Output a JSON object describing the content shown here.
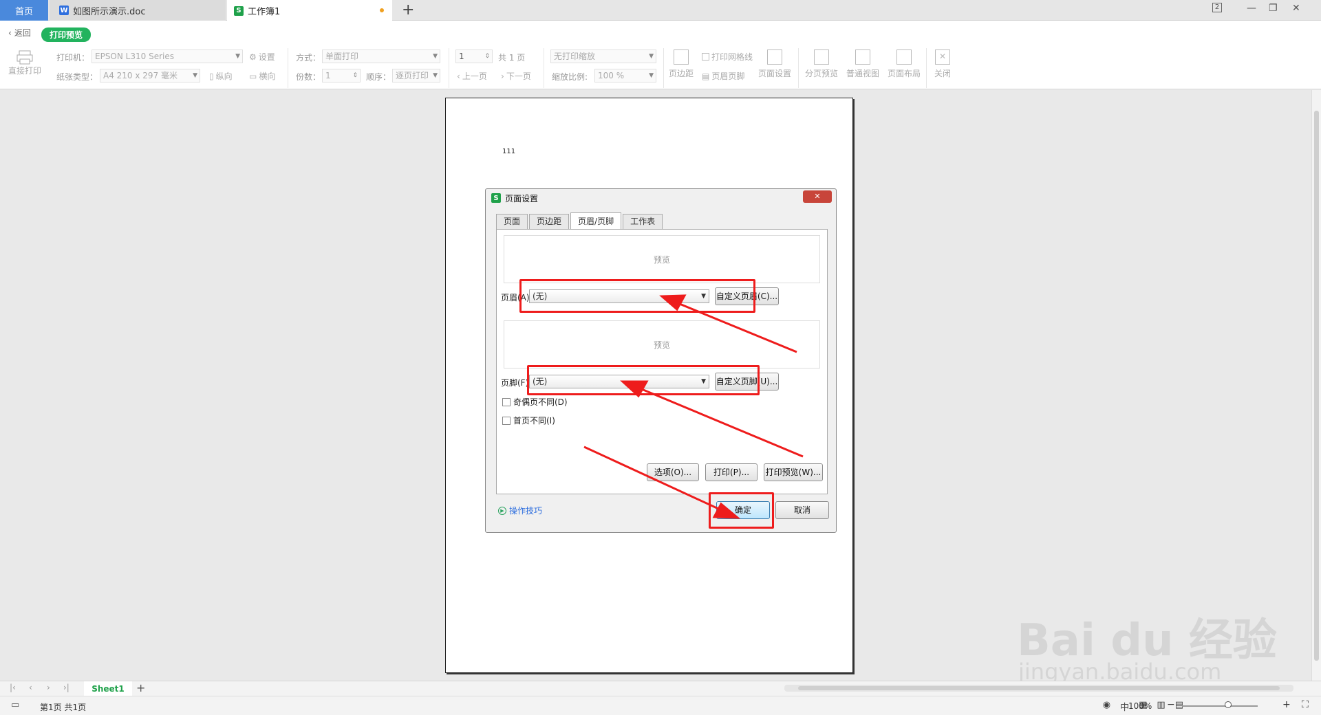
{
  "tabs": {
    "home": "首页",
    "doc": "如图所示演示.doc",
    "doc_badge": "W",
    "sheet": "工作簿1",
    "sheet_badge": "S",
    "new_tab": "+",
    "account_badge": "2"
  },
  "toolbar": {
    "back": "返回",
    "mode_badge": "打印预览",
    "direct_print": "直接打印",
    "printer_label": "打印机：",
    "printer_value": "EPSON L310 Series",
    "settings": "设置",
    "paper_label": "纸张类型：",
    "paper_value": "A4 210 x 297 毫米",
    "portrait": "纵向",
    "landscape": "横向",
    "method_label": "方式：",
    "method_value": "单面打印",
    "copies_label": "份数：",
    "copies_value": "1",
    "order_label": "顺序：",
    "order_value": "逐页打印",
    "page_value": "1",
    "page_total": "共 1 页",
    "prev_page": "上一页",
    "next_page": "下一页",
    "scaling_value": "无打印缩放",
    "scale_label": "缩放比例:",
    "scale_value": "100 %",
    "margins": "页边距",
    "print_grid": "打印网格线",
    "header_footer": "页眉页脚",
    "page_setup": "页面设置",
    "page_break_preview": "分页预览",
    "normal_view": "普通视图",
    "page_layout": "页面布局",
    "close": "关闭"
  },
  "paper": {
    "cell_text": "111"
  },
  "dialog": {
    "title": "页面设置",
    "app_badge": "S",
    "close": "✕",
    "tabs": [
      "页面",
      "页边距",
      "页眉/页脚",
      "工作表"
    ],
    "preview_label": "预览",
    "header_label": "页眉(A):",
    "header_value": "(无)",
    "custom_header": "自定义页眉(C)...",
    "footer_label": "页脚(F):",
    "footer_value": "(无)",
    "custom_footer": "自定义页脚(U)...",
    "odd_even": "奇偶页不同(D)",
    "first_page": "首页不同(I)",
    "options": "选项(O)...",
    "print": "打印(P)...",
    "print_preview": "打印预览(W)...",
    "tips": "操作技巧",
    "ok": "确定",
    "cancel": "取消"
  },
  "sheetbar": {
    "sheet_name": "Sheet1",
    "add": "+"
  },
  "status": {
    "page_info": "第1页 共1页",
    "ime": "中",
    "zoom": "100%"
  },
  "watermark": {
    "brand": "Bai du 经验",
    "url": "jingyan.baidu.com"
  },
  "colors": {
    "accent_green": "#22b35e",
    "highlight_red": "#ee1c1c",
    "home_blue": "#4a89dc"
  }
}
